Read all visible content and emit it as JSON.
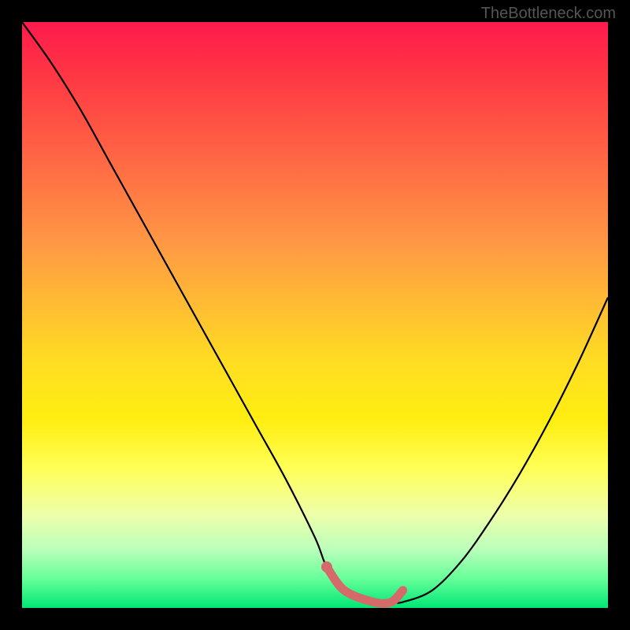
{
  "watermark": "TheBottleneck.com",
  "chart_data": {
    "type": "line",
    "title": "",
    "xlabel": "",
    "ylabel": "",
    "xlim": [
      0,
      100
    ],
    "ylim": [
      0,
      100
    ],
    "series": [
      {
        "name": "bottleneck-curve",
        "x": [
          0,
          5,
          10,
          15,
          20,
          25,
          30,
          35,
          40,
          45,
          50,
          52,
          55,
          60,
          63,
          65,
          70,
          75,
          80,
          85,
          90,
          95,
          100
        ],
        "y": [
          100,
          93,
          85,
          76,
          67,
          58,
          49,
          40,
          31,
          22,
          12,
          7,
          3,
          1,
          1,
          1,
          3,
          8,
          15,
          23,
          32,
          42,
          53
        ]
      },
      {
        "name": "highlight-segment",
        "x": [
          52,
          55,
          60,
          63,
          65
        ],
        "y": [
          7,
          3,
          1,
          1,
          3
        ],
        "color": "#d46a6a"
      }
    ],
    "gradient_stops": [
      {
        "pos": 0,
        "color": "#ff1a4d"
      },
      {
        "pos": 50,
        "color": "#ffdd22"
      },
      {
        "pos": 100,
        "color": "#00e676"
      }
    ]
  }
}
